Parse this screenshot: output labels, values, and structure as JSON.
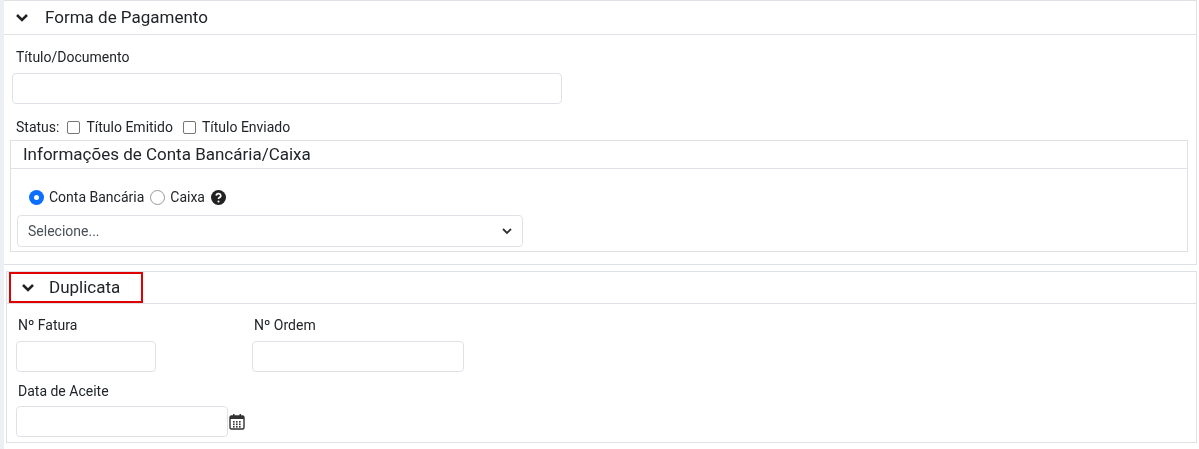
{
  "payment_section": {
    "title": "Forma de Pagamento",
    "expanded": true,
    "document_field": {
      "label": "Título/Documento"
    },
    "status": {
      "label": "Status:",
      "options": [
        {
          "label": "Título Emitido",
          "checked": false
        },
        {
          "label": "Título Enviado",
          "checked": false
        }
      ]
    },
    "account_panel": {
      "title": "Informações de Conta Bancária/Caixa",
      "options": [
        {
          "label": "Conta Bancária",
          "selected": true
        },
        {
          "label": "Caixa",
          "selected": false
        }
      ],
      "select": {
        "value": "Selecione..."
      }
    }
  },
  "duplicate_section": {
    "title": "Duplicata",
    "expanded": true,
    "highlighted": true,
    "fields": [
      {
        "label": "Nº Fatura"
      },
      {
        "label": "Nº Ordem"
      },
      {
        "label": "Data de Aceite"
      }
    ]
  }
}
